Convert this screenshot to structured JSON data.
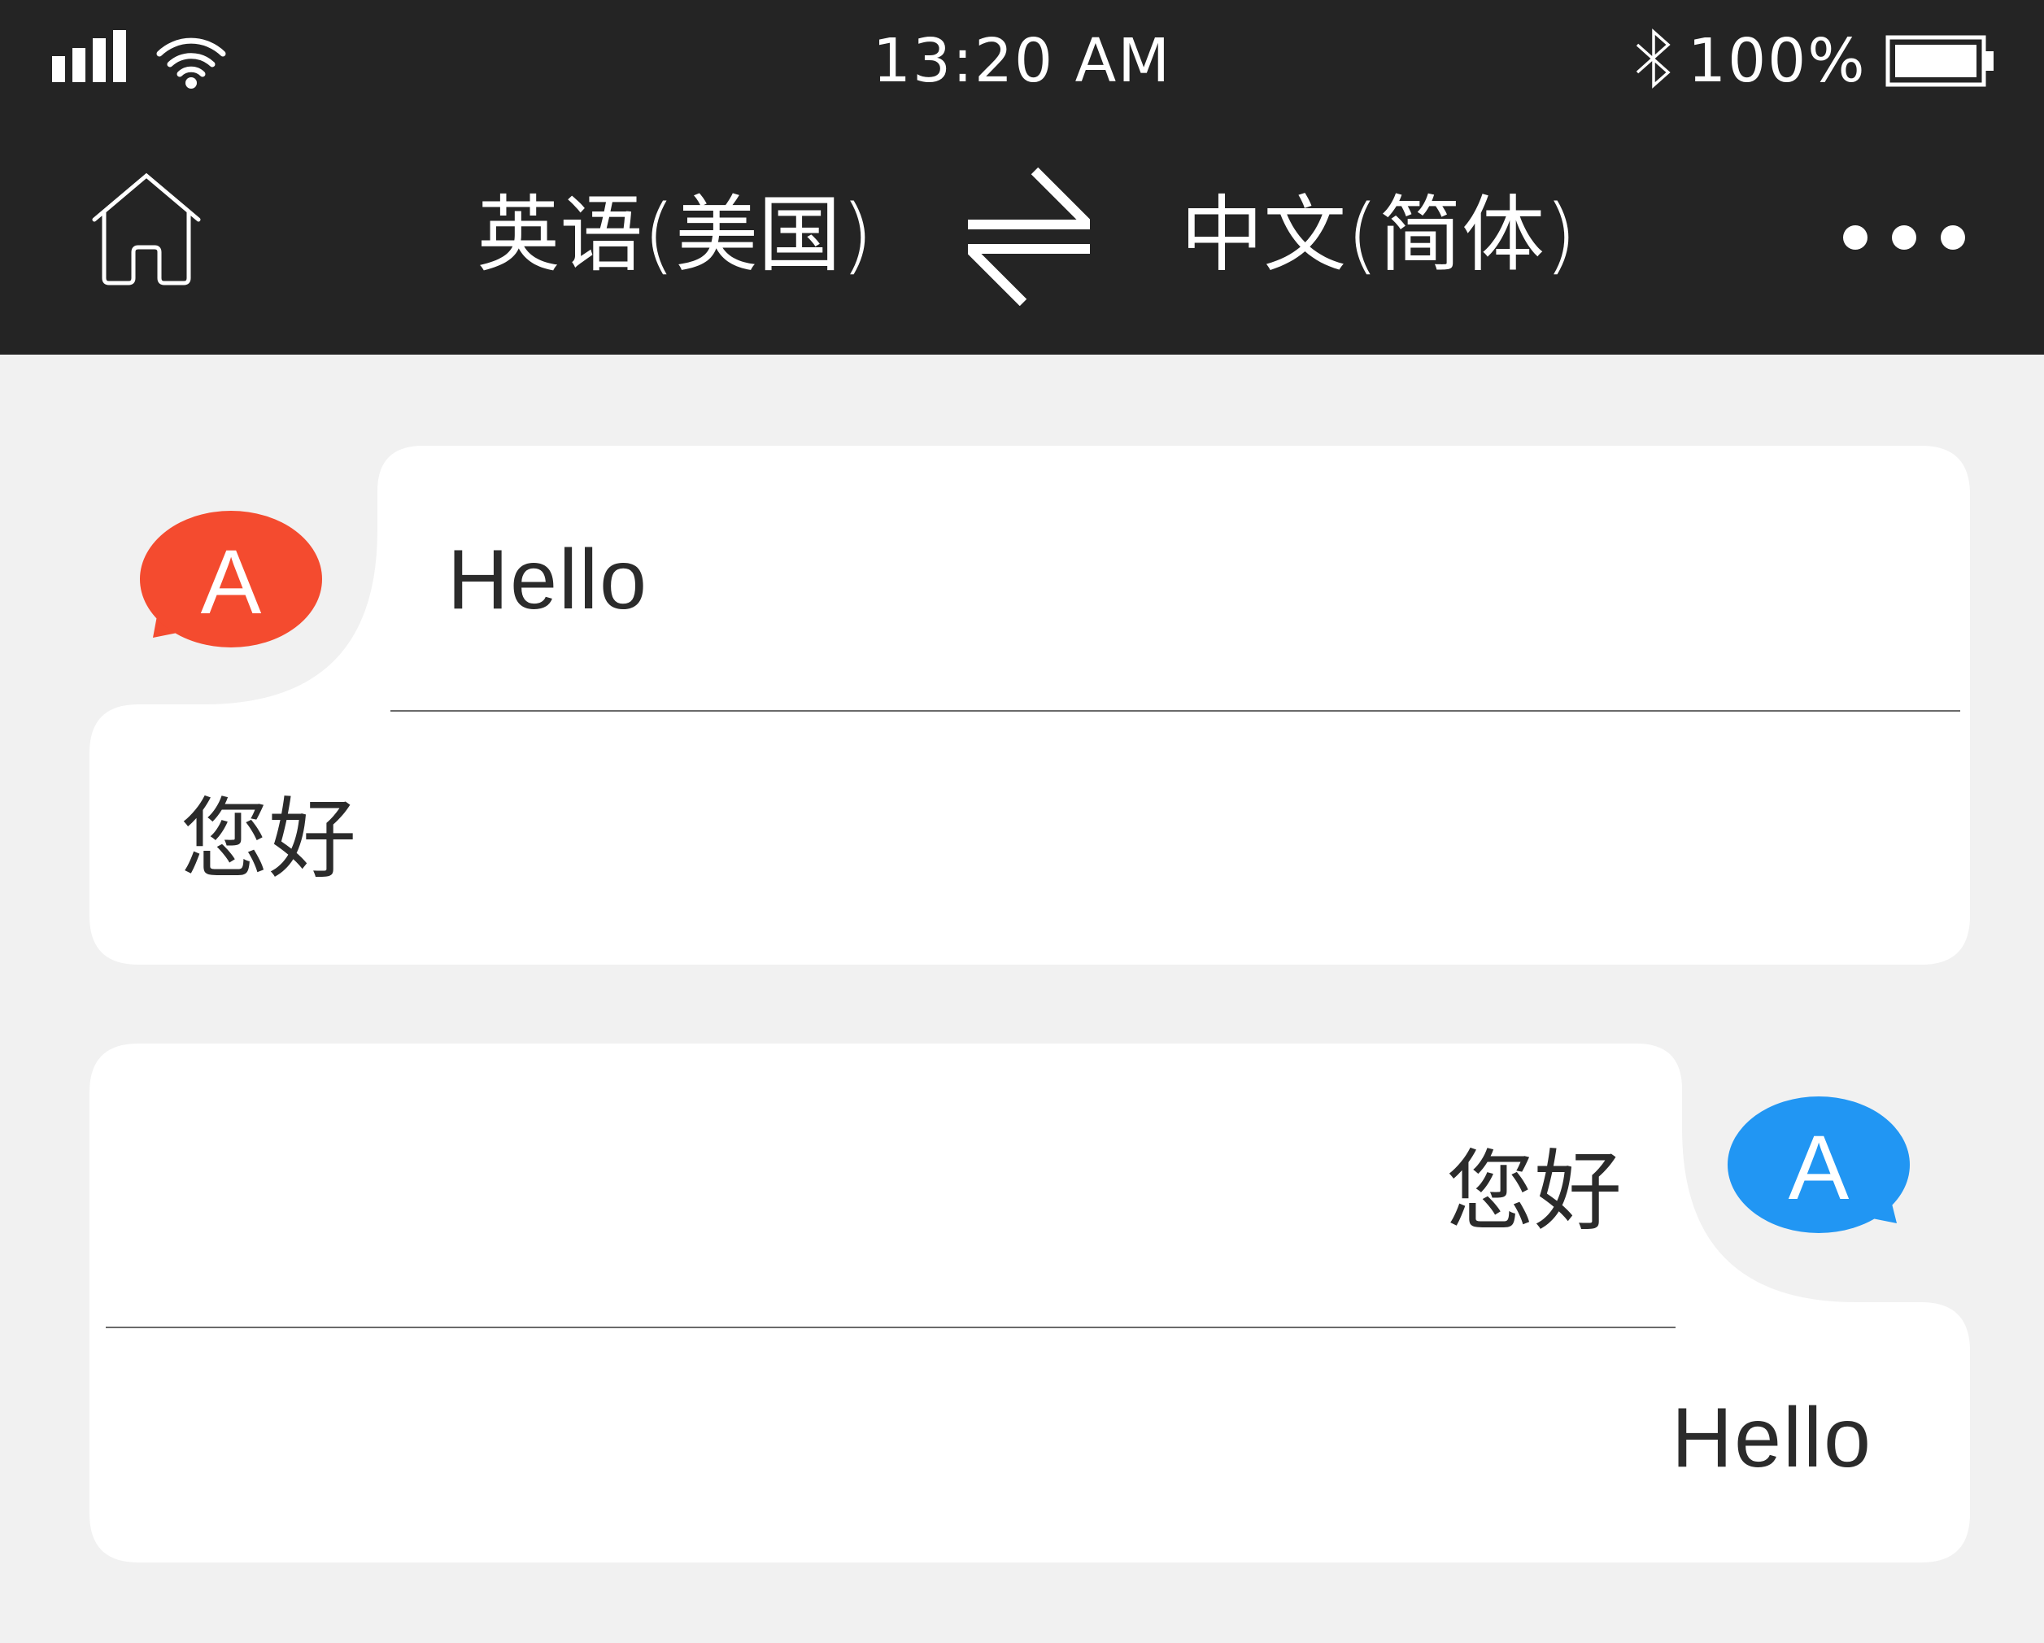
{
  "status_bar": {
    "time": "13:20 AM",
    "battery_percent": "100%",
    "battery_level": 1.0,
    "icons": [
      "cellular-signal-icon",
      "wifi-icon",
      "bluetooth-icon",
      "battery-icon"
    ]
  },
  "nav": {
    "home_icon": "home-icon",
    "source_language": "英语(美国)",
    "swap_icon": "swap-arrows-icon",
    "target_language": "中文(简体)",
    "more_icon": "more-dots-icon"
  },
  "conversation": [
    {
      "speaker": "A",
      "speaker_color": "#f44b2f",
      "side": "left",
      "original": "Hello",
      "translation": "您好"
    },
    {
      "speaker": "A",
      "speaker_color": "#2196f3",
      "side": "right",
      "original": "您好",
      "translation": "Hello"
    }
  ],
  "colors": {
    "header_background": "#242424",
    "page_background": "#f1f1f1",
    "card_background": "#ffffff",
    "text": "#2b2b2b"
  }
}
